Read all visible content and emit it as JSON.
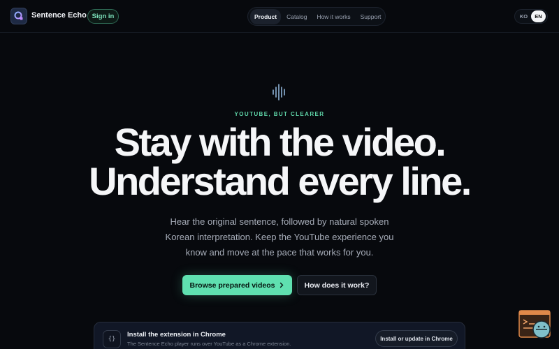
{
  "header": {
    "brand_name": "Sentence Echo",
    "signin_label": "Sign in",
    "nav": [
      "Product",
      "Catalog",
      "How it works",
      "Support"
    ],
    "active_nav": "Product",
    "languages": [
      "KO",
      "EN"
    ],
    "active_language": "EN"
  },
  "hero": {
    "eyebrow": "YOUTUBE, BUT CLEARER",
    "headline_line1": "Stay with the video.",
    "headline_line2": "Understand every line.",
    "subtext": "Hear the original sentence, followed by natural spoken Korean interpretation. Keep the YouTube experience you know and move at the pace that works for you.",
    "primary_cta": "Browse prepared videos",
    "secondary_cta": "How does it work?"
  },
  "install": {
    "icon_glyph": "{}",
    "title": "Install the extension in Chrome",
    "description": "The Sentence Echo player runs over YouTube as a Chrome extension.",
    "button_label": "Install or update in Chrome"
  },
  "colors": {
    "accent": "#5fe0b0",
    "background": "#07090d"
  },
  "icons": {
    "brand": "sentence-echo-logo",
    "wave": "sound-wave-icon",
    "cta_arrow": "chevron-right-icon",
    "mascot": "helper-mascot-icon"
  }
}
